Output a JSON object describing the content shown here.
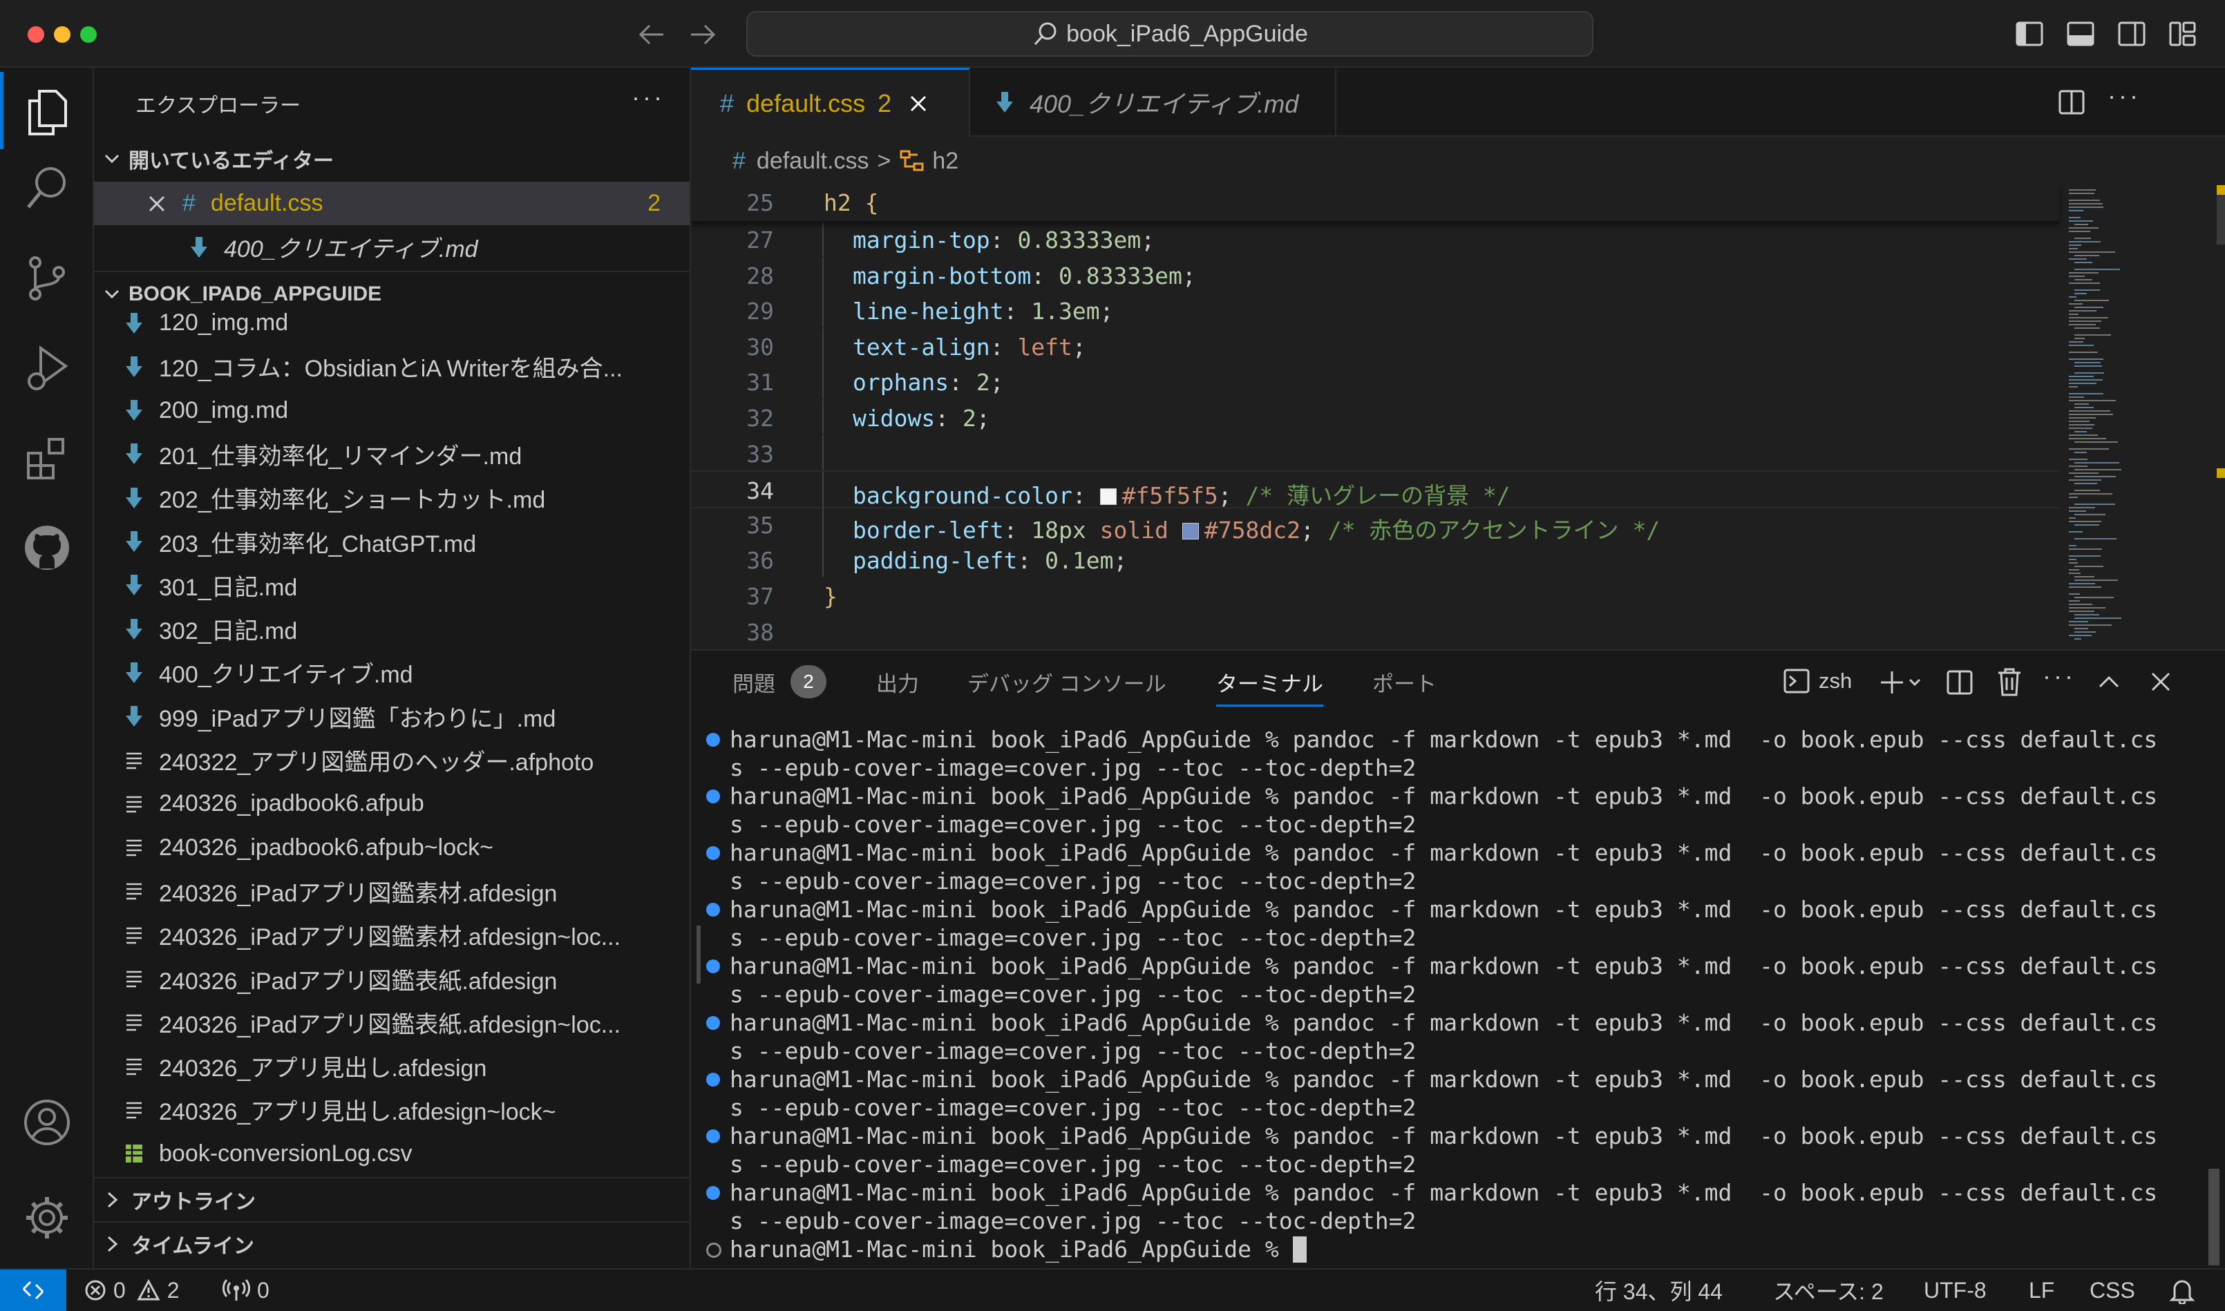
{
  "window": {
    "title": "book_iPad6_AppGuide",
    "traffic_colors": [
      "#ff5f57",
      "#febc2e",
      "#28c840"
    ]
  },
  "sidebar": {
    "header": "エクスプローラー",
    "open_editors_title": "開いているエディター",
    "open_editors": [
      {
        "name": "default.css",
        "badge": "2",
        "icon": "css-hash-icon"
      },
      {
        "name": "400_クリエイティブ.md",
        "icon": "markdown-arrow-icon"
      }
    ],
    "project_title": "BOOK_IPAD6_APPGUIDE",
    "files": [
      {
        "name": "120_img.md",
        "icon": "md"
      },
      {
        "name": "120_コラム：ObsidianとiA Writerを組み合...",
        "icon": "md"
      },
      {
        "name": "200_img.md",
        "icon": "md"
      },
      {
        "name": "201_仕事効率化_リマインダー.md",
        "icon": "md"
      },
      {
        "name": "202_仕事効率化_ショートカット.md",
        "icon": "md"
      },
      {
        "name": "203_仕事効率化_ChatGPT.md",
        "icon": "md"
      },
      {
        "name": "301_日記.md",
        "icon": "md"
      },
      {
        "name": "302_日記.md",
        "icon": "md"
      },
      {
        "name": "400_クリエイティブ.md",
        "icon": "md"
      },
      {
        "name": "999_iPadアプリ図鑑「おわりに」.md",
        "icon": "md"
      },
      {
        "name": "240322_アプリ図鑑用のヘッダー.afphoto",
        "icon": "file"
      },
      {
        "name": "240326_ipadbook6.afpub",
        "icon": "file"
      },
      {
        "name": "240326_ipadbook6.afpub~lock~",
        "icon": "file"
      },
      {
        "name": "240326_iPadアプリ図鑑素材.afdesign",
        "icon": "file"
      },
      {
        "name": "240326_iPadアプリ図鑑素材.afdesign~loc...",
        "icon": "file"
      },
      {
        "name": "240326_iPadアプリ図鑑表紙.afdesign",
        "icon": "file"
      },
      {
        "name": "240326_iPadアプリ図鑑表紙.afdesign~loc...",
        "icon": "file"
      },
      {
        "name": "240326_アプリ見出し.afdesign",
        "icon": "file"
      },
      {
        "name": "240326_アプリ見出し.afdesign~lock~",
        "icon": "file"
      },
      {
        "name": "book-conversionLog.csv",
        "icon": "csv"
      }
    ],
    "outline_title": "アウトライン",
    "timeline_title": "タイムライン"
  },
  "tabs": [
    {
      "hash": "#",
      "label": "default.css",
      "badge": "2",
      "active": true
    },
    {
      "label": "400_クリエイティブ.md",
      "active": false
    }
  ],
  "breadcrumb": {
    "hash": "#",
    "file": "default.css",
    "separator": ">",
    "symbol": "h2"
  },
  "editor": {
    "sticky": {
      "line": "25",
      "text": "h2 {"
    },
    "lines": [
      {
        "n": "27",
        "prop": "margin-top",
        "value": "0.83333em",
        "vclass": "num"
      },
      {
        "n": "28",
        "prop": "margin-bottom",
        "value": "0.83333em",
        "vclass": "num"
      },
      {
        "n": "29",
        "prop": "line-height",
        "value": "1.3em",
        "vclass": "num"
      },
      {
        "n": "30",
        "prop": "text-align",
        "value": "left",
        "vclass": "kw"
      },
      {
        "n": "31",
        "prop": "orphans",
        "value": "2",
        "vclass": "num"
      },
      {
        "n": "32",
        "prop": "widows",
        "value": "2",
        "vclass": "num"
      },
      {
        "n": "33"
      },
      {
        "n": "34",
        "prop": "background-color",
        "swatch": "#f5f5f5",
        "value": "#f5f5f5",
        "vclass": "kw",
        "comment": "/* 薄いグレーの背景 */",
        "current": true
      },
      {
        "n": "35",
        "prop": "border-left",
        "value": "18px",
        "vclass": "num",
        "value2": "solid",
        "swatch": "#758dc2",
        "value3": "#758dc2",
        "comment": "/* 赤色のアクセントライン */"
      },
      {
        "n": "36",
        "prop": "padding-left",
        "value": "0.1em",
        "vclass": "num"
      },
      {
        "n": "37",
        "brace": "}"
      },
      {
        "n": "38"
      }
    ],
    "colon": ":",
    "semicolon": ";"
  },
  "panel": {
    "tabs": [
      "問題",
      "出力",
      "デバッグ コンソール",
      "ターミナル",
      "ポート"
    ],
    "problems_badge": "2",
    "shell": "zsh",
    "terminal": {
      "line_a": "haruna@M1-Mac-mini book_iPad6_AppGuide % pandoc -f markdown -t epub3 *.md  -o book.epub --css default.cs",
      "line_b": "s --epub-cover-image=cover.jpg --toc --toc-depth=2",
      "repeat": 9,
      "prompt": "haruna@M1-Mac-mini book_iPad6_AppGuide % "
    }
  },
  "statusbar": {
    "errors": "0",
    "warnings": "2",
    "ports": "0",
    "position": "行 34、列 44",
    "spaces": "スペース: 2",
    "encoding": "UTF-8",
    "eol": "LF",
    "language": "CSS",
    "remote_color": "#0078d4"
  }
}
